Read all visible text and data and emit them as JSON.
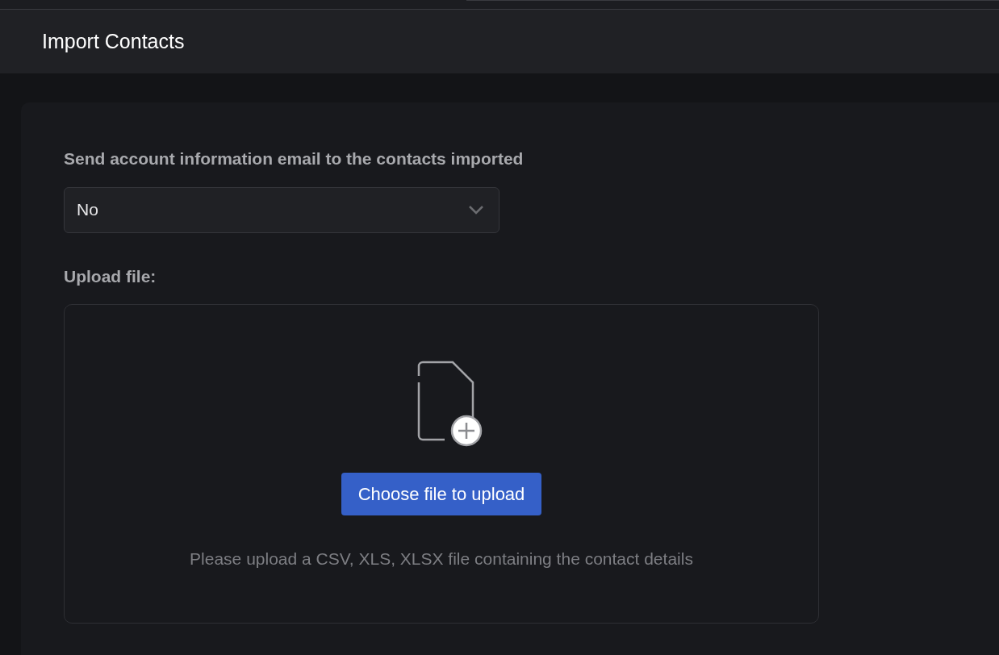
{
  "page": {
    "title": "Import Contacts"
  },
  "email_option": {
    "label": "Send account information email to the contacts imported",
    "value": "No"
  },
  "upload": {
    "label": "Upload file:",
    "button": "Choose file to upload",
    "hint": "Please upload a CSV, XLS, XLSX file containing the contact details"
  }
}
